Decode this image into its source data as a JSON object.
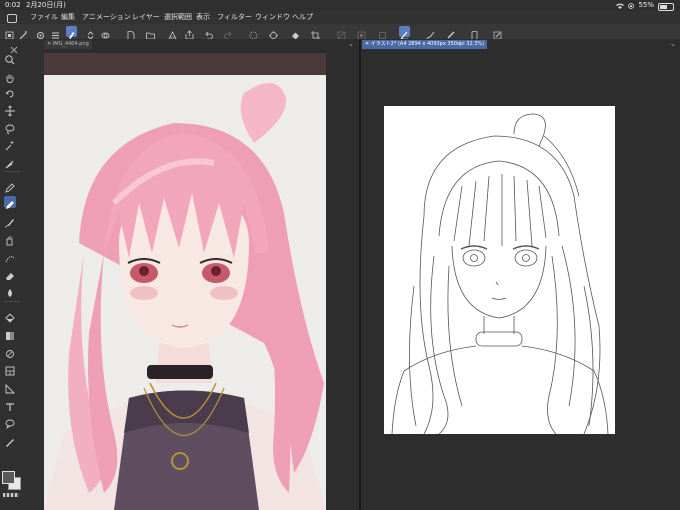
{
  "status_bar": {
    "time": "0:02",
    "date": "2月20日(月)",
    "battery": "55%"
  },
  "menu": {
    "items": [
      "ファイル",
      "編集",
      "アニメーション",
      "レイヤー",
      "選択範囲",
      "表示",
      "フィルター",
      "ウィンドウ",
      "ヘルプ"
    ]
  },
  "tabs": {
    "left": "IMG_4404.png",
    "right": "イラスト2* (A4 2894 x 4093px 350dpi 32.3%)"
  },
  "colors": {
    "accent": "#5a7fc4",
    "hair": "#f0a8bc",
    "eyes": "#c65a6a",
    "dress": "#5a4b5c",
    "lineart": "#555555"
  }
}
